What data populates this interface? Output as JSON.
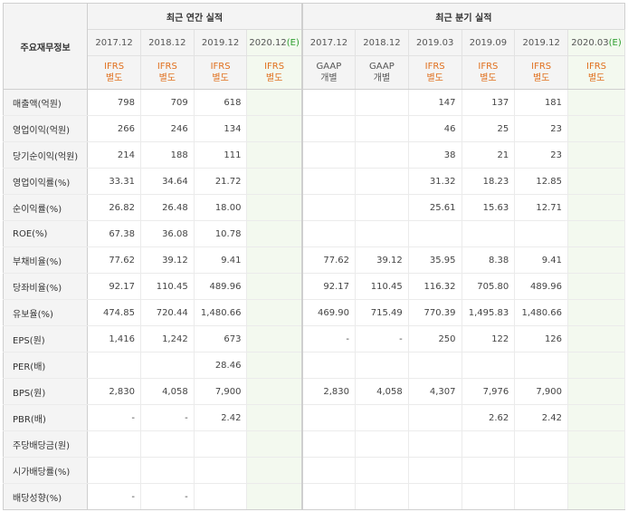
{
  "header": {
    "corner_label": "주요재무정보",
    "annual_group": "최근 연간 실적",
    "quarterly_group": "최근 분기 실적"
  },
  "columns": [
    {
      "period": "2017.12",
      "acct1": "IFRS",
      "acct2": "별도",
      "acct_type": "ifrs",
      "estimate": false,
      "est_mark": ""
    },
    {
      "period": "2018.12",
      "acct1": "IFRS",
      "acct2": "별도",
      "acct_type": "ifrs",
      "estimate": false,
      "est_mark": ""
    },
    {
      "period": "2019.12",
      "acct1": "IFRS",
      "acct2": "별도",
      "acct_type": "ifrs",
      "estimate": false,
      "est_mark": ""
    },
    {
      "period": "2020.12",
      "acct1": "IFRS",
      "acct2": "별도",
      "acct_type": "ifrs",
      "estimate": true,
      "est_mark": "(E)"
    },
    {
      "period": "2017.12",
      "acct1": "GAAP",
      "acct2": "개별",
      "acct_type": "gaap",
      "estimate": false,
      "est_mark": ""
    },
    {
      "period": "2018.12",
      "acct1": "GAAP",
      "acct2": "개별",
      "acct_type": "gaap",
      "estimate": false,
      "est_mark": ""
    },
    {
      "period": "2019.03",
      "acct1": "IFRS",
      "acct2": "별도",
      "acct_type": "ifrs",
      "estimate": false,
      "est_mark": ""
    },
    {
      "period": "2019.09",
      "acct1": "IFRS",
      "acct2": "별도",
      "acct_type": "ifrs",
      "estimate": false,
      "est_mark": ""
    },
    {
      "period": "2019.12",
      "acct1": "IFRS",
      "acct2": "별도",
      "acct_type": "ifrs",
      "estimate": false,
      "est_mark": ""
    },
    {
      "period": "2020.03",
      "acct1": "IFRS",
      "acct2": "별도",
      "acct_type": "ifrs",
      "estimate": true,
      "est_mark": "(E)"
    }
  ],
  "rows": [
    {
      "label": "매출액(억원)",
      "values": [
        "798",
        "709",
        "618",
        "",
        "",
        "",
        "147",
        "137",
        "181",
        ""
      ]
    },
    {
      "label": "영업이익(억원)",
      "values": [
        "266",
        "246",
        "134",
        "",
        "",
        "",
        "46",
        "25",
        "23",
        ""
      ]
    },
    {
      "label": "당기순이익(억원)",
      "values": [
        "214",
        "188",
        "111",
        "",
        "",
        "",
        "38",
        "21",
        "23",
        ""
      ]
    },
    {
      "label": "영업이익률(%)",
      "values": [
        "33.31",
        "34.64",
        "21.72",
        "",
        "",
        "",
        "31.32",
        "18.23",
        "12.85",
        ""
      ]
    },
    {
      "label": "순이익률(%)",
      "values": [
        "26.82",
        "26.48",
        "18.00",
        "",
        "",
        "",
        "25.61",
        "15.63",
        "12.71",
        ""
      ]
    },
    {
      "label": "ROE(%)",
      "values": [
        "67.38",
        "36.08",
        "10.78",
        "",
        "",
        "",
        "",
        "",
        "",
        ""
      ]
    },
    {
      "label": "부채비율(%)",
      "values": [
        "77.62",
        "39.12",
        "9.41",
        "",
        "77.62",
        "39.12",
        "35.95",
        "8.38",
        "9.41",
        ""
      ]
    },
    {
      "label": "당좌비율(%)",
      "values": [
        "92.17",
        "110.45",
        "489.96",
        "",
        "92.17",
        "110.45",
        "116.32",
        "705.80",
        "489.96",
        ""
      ]
    },
    {
      "label": "유보율(%)",
      "values": [
        "474.85",
        "720.44",
        "1,480.66",
        "",
        "469.90",
        "715.49",
        "770.39",
        "1,495.83",
        "1,480.66",
        ""
      ]
    },
    {
      "label": "EPS(원)",
      "values": [
        "1,416",
        "1,242",
        "673",
        "",
        "-",
        "-",
        "250",
        "122",
        "126",
        ""
      ]
    },
    {
      "label": "PER(배)",
      "values": [
        "",
        "",
        "28.46",
        "",
        "",
        "",
        "",
        "",
        "",
        ""
      ]
    },
    {
      "label": "BPS(원)",
      "values": [
        "2,830",
        "4,058",
        "7,900",
        "",
        "2,830",
        "4,058",
        "4,307",
        "7,976",
        "7,900",
        ""
      ]
    },
    {
      "label": "PBR(배)",
      "values": [
        "-",
        "-",
        "2.42",
        "",
        "",
        "",
        "",
        "2.62",
        "2.42",
        ""
      ]
    },
    {
      "label": "주당배당금(원)",
      "values": [
        "",
        "",
        "",
        "",
        "",
        "",
        "",
        "",
        "",
        ""
      ]
    },
    {
      "label": "시가배당률(%)",
      "values": [
        "",
        "",
        "",
        "",
        "",
        "",
        "",
        "",
        "",
        ""
      ]
    },
    {
      "label": "배당성향(%)",
      "values": [
        "-",
        "-",
        "",
        "",
        "",
        "",
        "",
        "",
        "",
        ""
      ]
    }
  ],
  "colors": {
    "header_bg": "#f4f4f4",
    "ifrs_orange": "#e0701e",
    "estimate_green": "#2d9d2d",
    "estimate_bg": "#f3f9ef"
  }
}
